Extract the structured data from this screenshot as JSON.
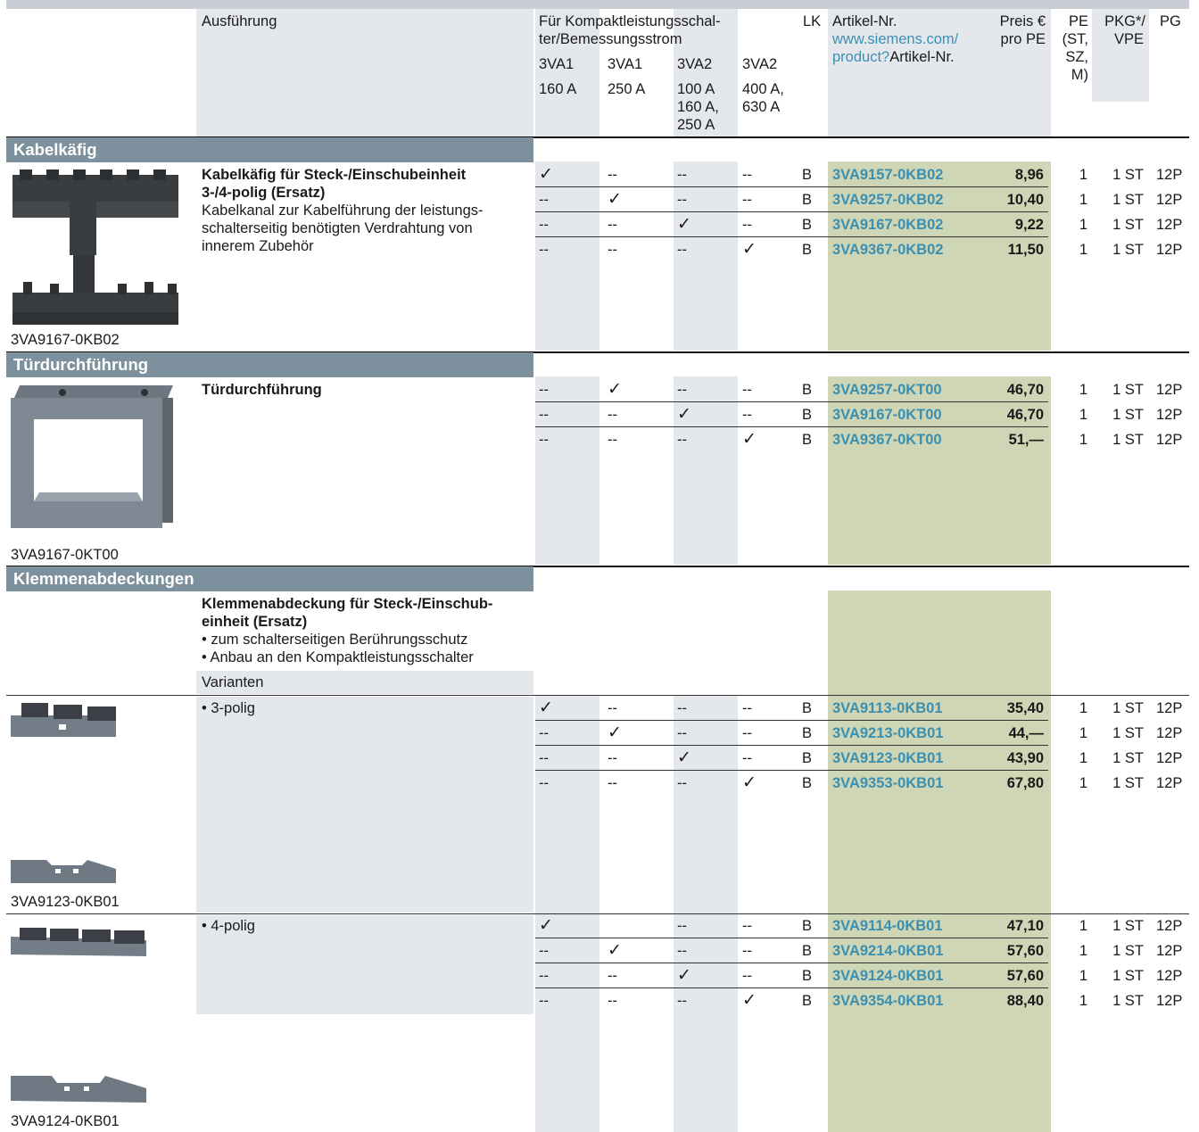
{
  "header": {
    "ausfuehrung": "Ausführung",
    "fuer_line1": "Für Kompaktleistungsschal-",
    "fuer_line2": "ter/Bemessungsstrom",
    "cols": [
      {
        "type": "3VA1",
        "current": [
          "160 A"
        ]
      },
      {
        "type": "3VA1",
        "current": [
          "250 A"
        ]
      },
      {
        "type": "3VA2",
        "current": [
          "100 A",
          "160 A,",
          "250 A"
        ]
      },
      {
        "type": "3VA2",
        "current": [
          "400 A,",
          "630 A"
        ]
      }
    ],
    "lk": "LK",
    "artikel": "Artikel-Nr.",
    "url_line1": "www.siemens.com/",
    "url_line2": "product?",
    "url_line2b": "Artikel-Nr.",
    "preis_line1": "Preis €",
    "preis_line2": "pro PE",
    "pe": [
      "PE",
      "(ST,",
      "SZ,",
      "M)"
    ],
    "pkg": [
      "PKG*/",
      "VPE"
    ],
    "pg": "PG"
  },
  "sections": [
    {
      "title": "Kabelkäfig",
      "image_caption": "3VA9167-0KB02",
      "desc_bold": [
        "Kabelkäfig für Steck-/Einschubeinheit",
        "3-/4-polig (Ersatz)"
      ],
      "desc": [
        "Kabelkanal zur Kabelführung der leistungs-",
        "schalterseitig benötigten Verdrahtung von",
        "innerem Zubehör"
      ],
      "rows": [
        {
          "c": [
            "✓",
            "--",
            "--",
            "--"
          ],
          "lk": "B",
          "art": "3VA9157-0KB02",
          "price": "8,96",
          "pe": "1",
          "pkg": "1 ST",
          "pg": "12P"
        },
        {
          "c": [
            "--",
            "✓",
            "--",
            "--"
          ],
          "lk": "B",
          "art": "3VA9257-0KB02",
          "price": "10,40",
          "pe": "1",
          "pkg": "1 ST",
          "pg": "12P"
        },
        {
          "c": [
            "--",
            "--",
            "✓",
            "--"
          ],
          "lk": "B",
          "art": "3VA9167-0KB02",
          "price": "9,22",
          "pe": "1",
          "pkg": "1 ST",
          "pg": "12P"
        },
        {
          "c": [
            "--",
            "--",
            "--",
            "✓"
          ],
          "lk": "B",
          "art": "3VA9367-0KB02",
          "price": "11,50",
          "pe": "1",
          "pkg": "1 ST",
          "pg": "12P"
        }
      ]
    },
    {
      "title": "Türdurchführung",
      "image_caption": "3VA9167-0KT00",
      "desc_bold": [
        "Türdurchführung"
      ],
      "rows": [
        {
          "c": [
            "--",
            "✓",
            "--",
            "--"
          ],
          "lk": "B",
          "art": "3VA9257-0KT00",
          "price": "46,70",
          "pe": "1",
          "pkg": "1 ST",
          "pg": "12P"
        },
        {
          "c": [
            "--",
            "--",
            "✓",
            "--"
          ],
          "lk": "B",
          "art": "3VA9167-0KT00",
          "price": "46,70",
          "pe": "1",
          "pkg": "1 ST",
          "pg": "12P"
        },
        {
          "c": [
            "--",
            "--",
            "--",
            "✓"
          ],
          "lk": "B",
          "art": "3VA9367-0KT00",
          "price": "51,—",
          "pe": "1",
          "pkg": "1 ST",
          "pg": "12P"
        }
      ]
    },
    {
      "title": "Klemmenabdeckungen",
      "desc_bold": [
        "Klemmenabdeckung für Steck-/Einschub-",
        "einheit (Ersatz)"
      ],
      "desc": [
        "• zum schalterseitigen Berührungsschutz",
        "• Anbau an den Kompaktleistungsschalter"
      ],
      "varianten": "Varianten",
      "groups": [
        {
          "label": "• 3-polig",
          "image_caption": "3VA9123-0KB01",
          "rows": [
            {
              "c": [
                "✓",
                "--",
                "--",
                "--"
              ],
              "lk": "B",
              "art": "3VA9113-0KB01",
              "price": "35,40",
              "pe": "1",
              "pkg": "1 ST",
              "pg": "12P"
            },
            {
              "c": [
                "--",
                "✓",
                "--",
                "--"
              ],
              "lk": "B",
              "art": "3VA9213-0KB01",
              "price": "44,—",
              "pe": "1",
              "pkg": "1 ST",
              "pg": "12P"
            },
            {
              "c": [
                "--",
                "--",
                "✓",
                "--"
              ],
              "lk": "B",
              "art": "3VA9123-0KB01",
              "price": "43,90",
              "pe": "1",
              "pkg": "1 ST",
              "pg": "12P"
            },
            {
              "c": [
                "--",
                "--",
                "--",
                "✓"
              ],
              "lk": "B",
              "art": "3VA9353-0KB01",
              "price": "67,80",
              "pe": "1",
              "pkg": "1 ST",
              "pg": "12P"
            }
          ]
        },
        {
          "label": "• 4-polig",
          "image_caption": "3VA9124-0KB01",
          "rows": [
            {
              "c": [
                "✓",
                "",
                "--",
                "--"
              ],
              "lk": "B",
              "art": "3VA9114-0KB01",
              "price": "47,10",
              "pe": "1",
              "pkg": "1 ST",
              "pg": "12P"
            },
            {
              "c": [
                "--",
                "✓",
                "--",
                "--"
              ],
              "lk": "B",
              "art": "3VA9214-0KB01",
              "price": "57,60",
              "pe": "1",
              "pkg": "1 ST",
              "pg": "12P"
            },
            {
              "c": [
                "--",
                "--",
                "✓",
                "--"
              ],
              "lk": "B",
              "art": "3VA9124-0KB01",
              "price": "57,60",
              "pe": "1",
              "pkg": "1 ST",
              "pg": "12P"
            },
            {
              "c": [
                "--",
                "--",
                "--",
                "✓"
              ],
              "lk": "B",
              "art": "3VA9354-0KB01",
              "price": "88,40",
              "pe": "1",
              "pkg": "1 ST",
              "pg": "12P"
            }
          ]
        }
      ]
    }
  ],
  "colors": {
    "section_bar": "#7d909d",
    "shade": "#e4e8ec",
    "green": "#cfd6b5",
    "link": "#3b8fb0"
  },
  "images": [
    "cable-cage-image",
    "door-feedthrough-image",
    "terminal-cover-3pole-image",
    "terminal-cover-4pole-image"
  ]
}
